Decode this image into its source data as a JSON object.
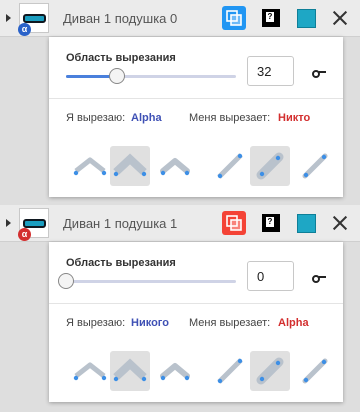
{
  "colors": {
    "accent_blue": "#2196f3",
    "accent_red": "#f44336",
    "alpha_link": "#3f51b5",
    "none_link": "#d32f2f",
    "swatch": "#1ea7c5"
  },
  "panels": [
    {
      "name": "Диван 1 подушка 0",
      "badge": "α",
      "badge_color": "#2a62c9",
      "pill_color": "#1b9ec0",
      "clip_color": "#2196f3",
      "slider_label": "Область вырезания",
      "slider_fraction": 0.3,
      "value": "32",
      "clips_label": "Я вырезаю:",
      "clips_value": "Alpha",
      "clips_color": "#3f51b5",
      "clipped_by_label": "Меня вырезает:",
      "clipped_by_value": "Никто",
      "clipped_by_color": "#d32f2f",
      "help_icon": "question-icon",
      "selected_modes": [
        1,
        4
      ]
    },
    {
      "name": "Диван 1 подушка 1",
      "badge": "α",
      "badge_color": "#d32f2f",
      "pill_color": "#1b9ec0",
      "clip_color": "#f44336",
      "slider_label": "Область вырезания",
      "slider_fraction": 0.0,
      "value": "0",
      "clips_label": "Я вырезаю:",
      "clips_value": "Никого",
      "clips_color": "#3f51b5",
      "clipped_by_label": "Меня вырезает:",
      "clipped_by_value": "Alpha",
      "clipped_by_color": "#d32f2f",
      "help_icon": "question-icon",
      "selected_modes": [
        1,
        4
      ]
    }
  ],
  "mode_icons": [
    "corner-thin-icon",
    "corner-wide-icon",
    "corner-round-icon",
    "edge-thin-icon",
    "edge-wide-icon",
    "edge-round-icon"
  ]
}
